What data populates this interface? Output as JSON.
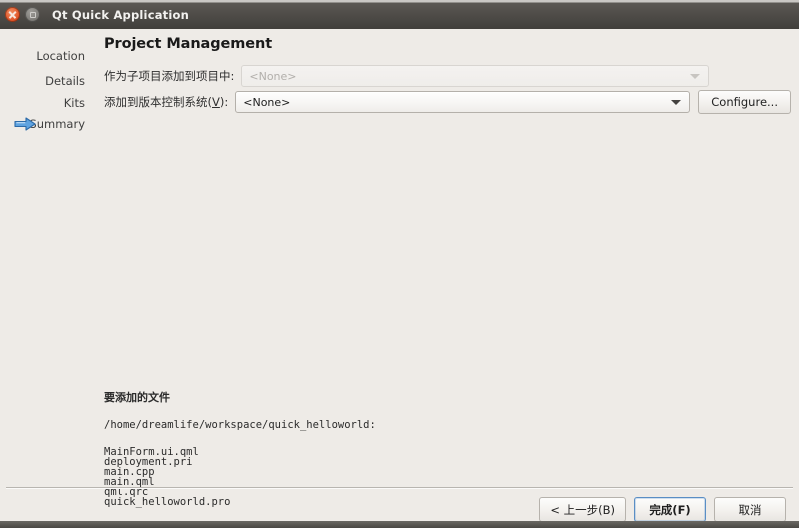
{
  "window": {
    "title": "Qt Quick Application",
    "controls": {
      "close": "close-button",
      "maximize": "maximize-button"
    }
  },
  "sidebar": {
    "items": [
      {
        "label": "Location",
        "current": false
      },
      {
        "label": "Details",
        "current": false
      },
      {
        "label": "Kits",
        "current": false
      },
      {
        "label": "Summary",
        "current": true
      }
    ]
  },
  "main": {
    "title": "Project Management",
    "rows": [
      {
        "label": "作为子项目添加到项目中:",
        "value": "<None>",
        "enabled": false
      },
      {
        "label_before": "添加到版本控制系统(",
        "label_accel": "V",
        "label_after": "):",
        "value": "<None>",
        "enabled": true,
        "button": "Configure..."
      }
    ],
    "files": {
      "heading": "要添加的文件",
      "path": "/home/dreamlife/workspace/quick_helloworld:",
      "list": [
        "MainForm.ui.qml",
        "deployment.pri",
        "main.cpp",
        "main.qml",
        "qml.qrc",
        "quick_helloworld.pro"
      ]
    }
  },
  "footer": {
    "back": "< 上一步(B)",
    "finish": "完成(F)",
    "cancel": "取消"
  },
  "colors": {
    "window_background": "#eeebe7",
    "titlebar_dark": "#4e4b47",
    "close_button": "#e2562a",
    "default_button_border": "#5a8ec4",
    "step_arrow": "#4a8fd4"
  }
}
